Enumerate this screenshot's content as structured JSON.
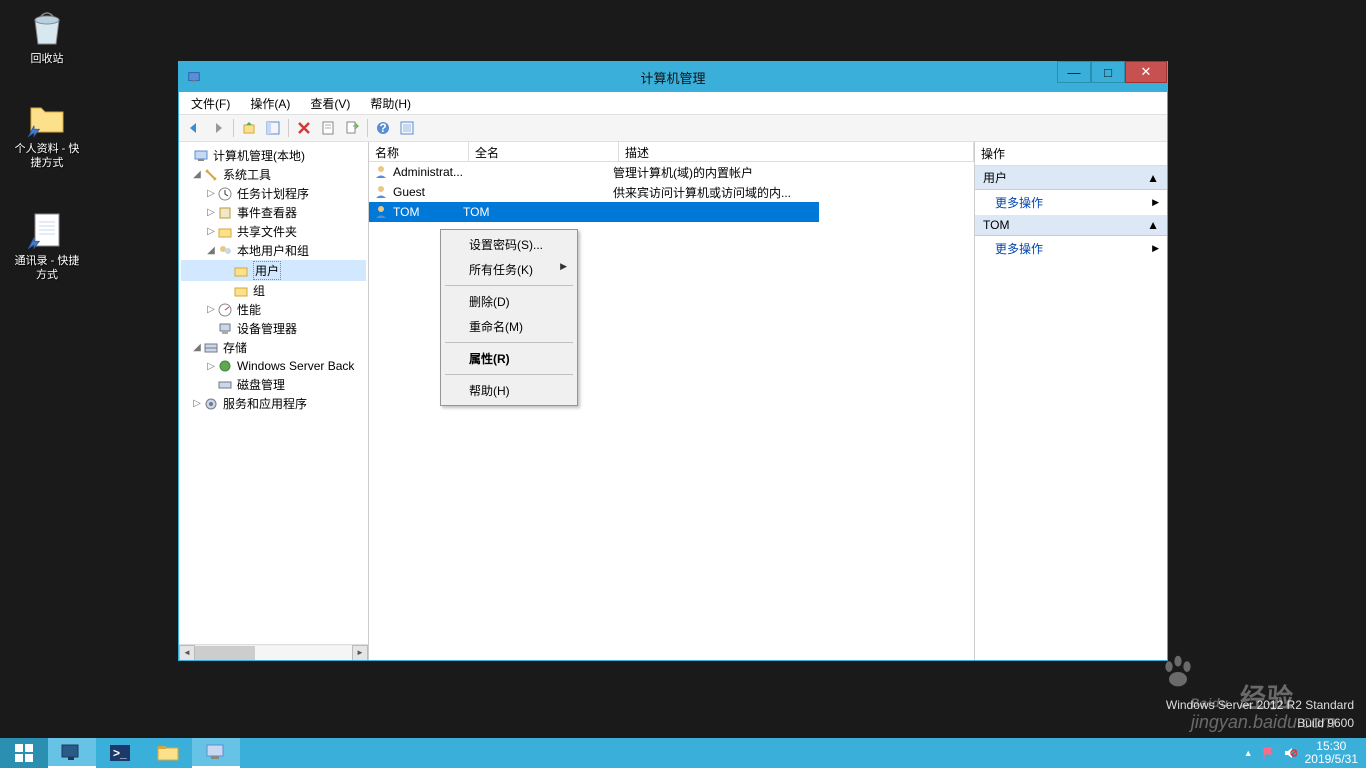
{
  "desktop": {
    "icons": [
      {
        "label": "回收站"
      },
      {
        "label": "个人资料 - 快捷方式"
      },
      {
        "label": "通讯录 - 快捷方式"
      }
    ]
  },
  "window": {
    "title": "计算机管理",
    "menu": {
      "file": "文件(F)",
      "action": "操作(A)",
      "view": "查看(V)",
      "help": "帮助(H)"
    }
  },
  "tree": {
    "root": "计算机管理(本地)",
    "system_tools": "系统工具",
    "task_scheduler": "任务计划程序",
    "event_viewer": "事件查看器",
    "shared_folders": "共享文件夹",
    "local_users_groups": "本地用户和组",
    "users": "用户",
    "groups": "组",
    "performance": "性能",
    "device_manager": "设备管理器",
    "storage": "存储",
    "windows_server_backup": "Windows Server Back",
    "disk_management": "磁盘管理",
    "services_apps": "服务和应用程序"
  },
  "list": {
    "headers": {
      "name": "名称",
      "fullname": "全名",
      "description": "描述"
    },
    "rows": [
      {
        "name": "Administrat...",
        "fullname": "",
        "description": "管理计算机(域)的内置帐户"
      },
      {
        "name": "Guest",
        "fullname": "",
        "description": "供来宾访问计算机或访问域的内..."
      },
      {
        "name": "TOM",
        "fullname": "TOM",
        "description": ""
      }
    ]
  },
  "context_menu": {
    "set_password": "设置密码(S)...",
    "all_tasks": "所有任务(K)",
    "delete": "删除(D)",
    "rename": "重命名(M)",
    "properties": "属性(R)",
    "help": "帮助(H)"
  },
  "actions": {
    "title": "操作",
    "section1": "用户",
    "more1": "更多操作",
    "section2": "TOM",
    "more2": "更多操作"
  },
  "watermark": {
    "line1": "Windows Server 2012 R2 Standard",
    "line2": "Build 9600",
    "logo": "Baidu",
    "logo_sub": "经验",
    "url": "jingyan.baidu.com"
  },
  "systray": {
    "time": "15:30",
    "date": "2019/5/31"
  }
}
